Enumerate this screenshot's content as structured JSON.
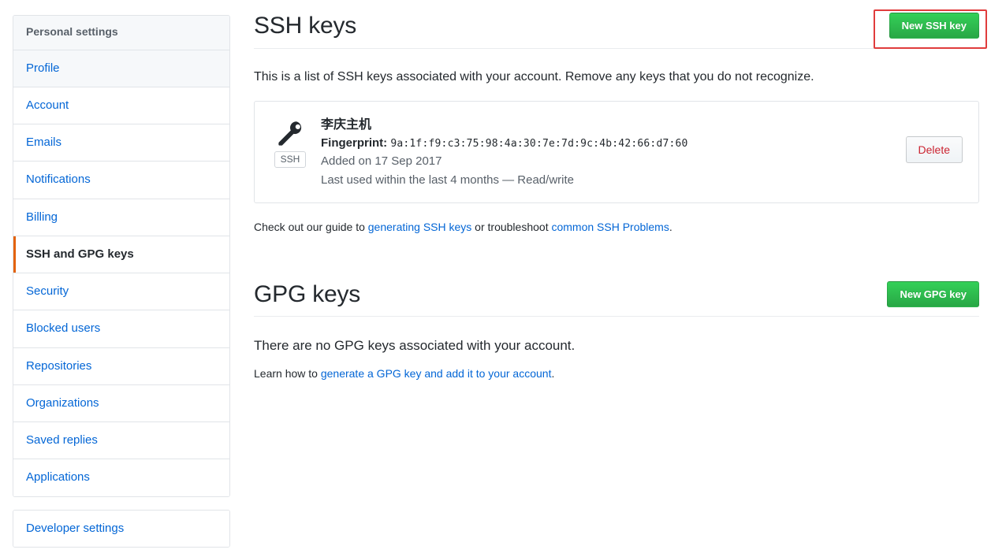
{
  "sidebar": {
    "header": "Personal settings",
    "items": [
      {
        "label": "Profile",
        "state": "tinted"
      },
      {
        "label": "Account",
        "state": "normal"
      },
      {
        "label": "Emails",
        "state": "normal"
      },
      {
        "label": "Notifications",
        "state": "normal"
      },
      {
        "label": "Billing",
        "state": "normal"
      },
      {
        "label": "SSH and GPG keys",
        "state": "selected"
      },
      {
        "label": "Security",
        "state": "normal"
      },
      {
        "label": "Blocked users",
        "state": "normal"
      },
      {
        "label": "Repositories",
        "state": "normal"
      },
      {
        "label": "Organizations",
        "state": "normal"
      },
      {
        "label": "Saved replies",
        "state": "normal"
      },
      {
        "label": "Applications",
        "state": "normal"
      }
    ],
    "developer_settings": "Developer settings"
  },
  "ssh_section": {
    "title": "SSH keys",
    "new_key_button": "New SSH key",
    "description": "This is a list of SSH keys associated with your account. Remove any keys that you do not recognize.",
    "key": {
      "icon": "key-icon",
      "badge": "SSH",
      "name": "李庆主机",
      "fingerprint_label": "Fingerprint:",
      "fingerprint_value": "9a:1f:f9:c3:75:98:4a:30:7e:7d:9c:4b:42:66:d7:60",
      "added_on": "Added on 17 Sep 2017",
      "last_used": "Last used within the last 4 months — Read/write",
      "delete_button": "Delete"
    },
    "guide_prefix": "Check out our guide to ",
    "guide_link_1": "generating SSH keys",
    "guide_middle": " or troubleshoot ",
    "guide_link_2": "common SSH Problems",
    "guide_suffix": "."
  },
  "gpg_section": {
    "title": "GPG keys",
    "new_key_button": "New GPG key",
    "empty_message": "There are no GPG keys associated with your account.",
    "learn_prefix": "Learn how to ",
    "learn_link": "generate a GPG key and add it to your account",
    "learn_suffix": "."
  },
  "highlight": {
    "target": "New SSH key",
    "color": "#e03c3c"
  },
  "colors": {
    "accent_link": "#0366d6",
    "green_button": "#28a745",
    "selected_marker": "#e36209",
    "danger_text": "#cb2431",
    "border": "#e1e4e8"
  }
}
